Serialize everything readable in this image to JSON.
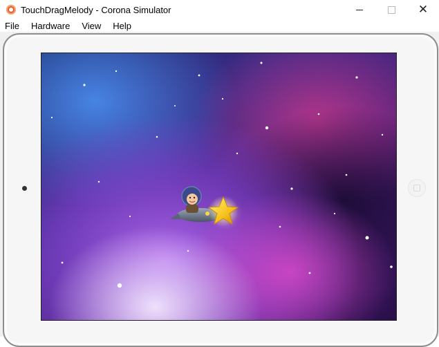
{
  "window": {
    "title": "TouchDragMelody - Corona Simulator",
    "app_icon": "corona-logo-icon",
    "controls": [
      "minimize-icon",
      "maximize-icon",
      "close-icon"
    ],
    "close_glyph": "✕"
  },
  "menu": {
    "items": [
      {
        "label": "File"
      },
      {
        "label": "Hardware"
      },
      {
        "label": "View"
      },
      {
        "label": "Help"
      }
    ]
  },
  "simulator": {
    "device": "tablet",
    "scene": "space-nebula-background",
    "sprites": [
      "astronaut-sprite",
      "rocket-sprite",
      "star-sprite"
    ]
  },
  "colors": {
    "nebula_purple": "#7a3fd0",
    "nebula_blue": "#2c56b8",
    "nebula_pink": "#c23aa6",
    "star_yellow": "#f6c21c",
    "app_icon_orange": "#e85a1f"
  }
}
